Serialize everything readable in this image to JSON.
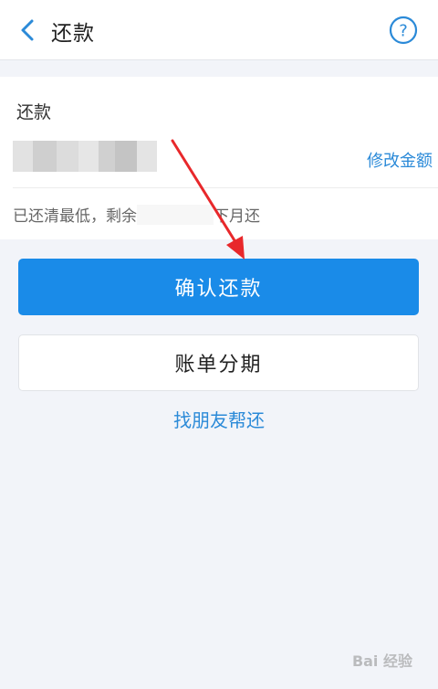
{
  "header": {
    "title": "还款",
    "help_symbol": "?"
  },
  "card": {
    "label": "还款",
    "edit_amount_label": "修改金额",
    "note_prefix": "已还清最低，剩余",
    "note_suffix": "下月还"
  },
  "actions": {
    "confirm_label": "确认还款",
    "installment_label": "账单分期",
    "friend_label": "找朋友帮还"
  },
  "watermark": {
    "text": "Bai 经验"
  },
  "colors": {
    "accent": "#1a8be8",
    "link": "#2b8ad8",
    "annotation": "#e8282b"
  }
}
